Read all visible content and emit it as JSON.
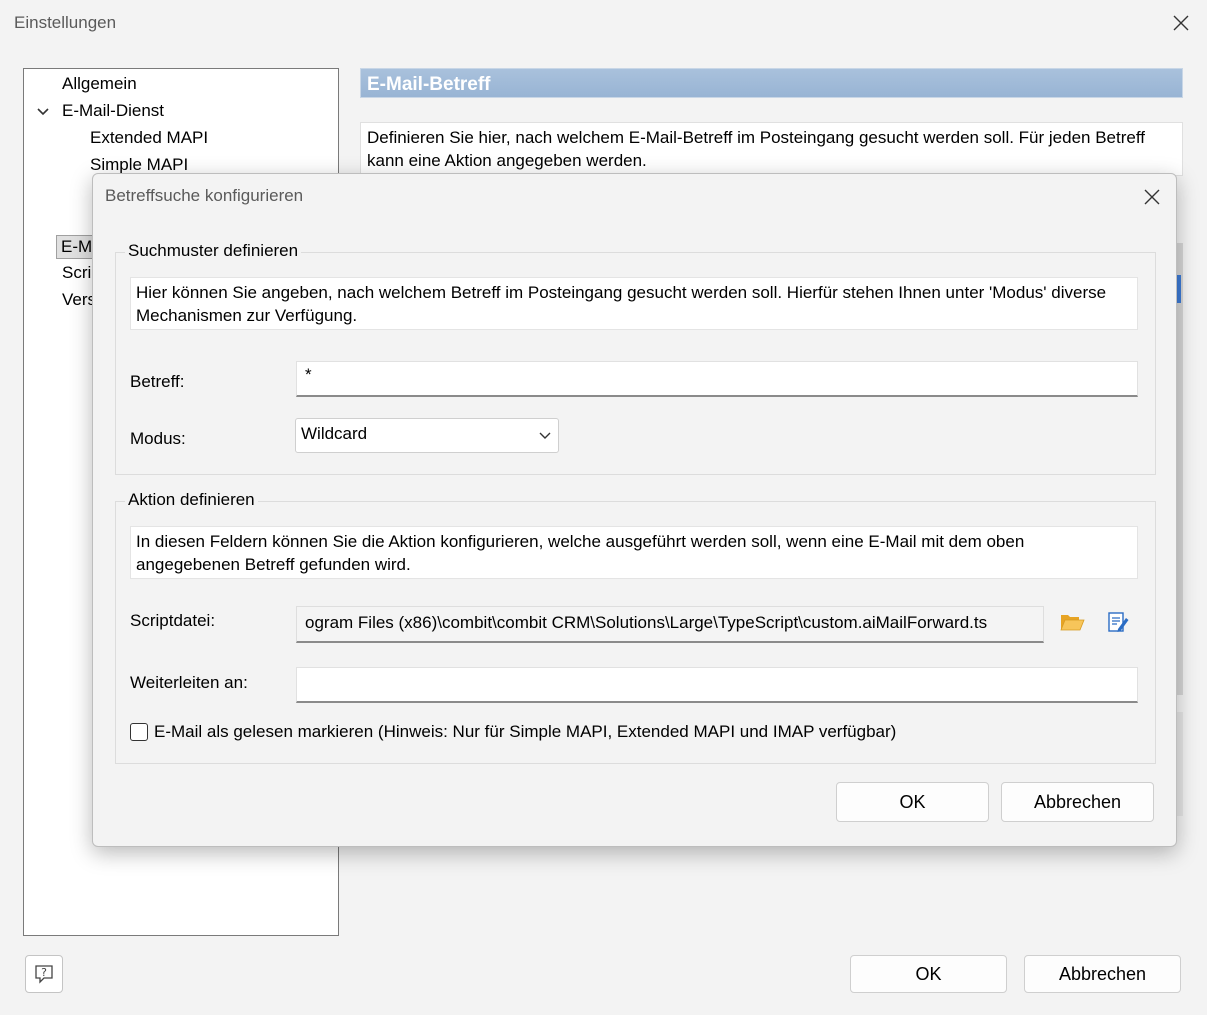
{
  "main": {
    "title": "Einstellungen",
    "tree": [
      {
        "label": "Allgemein"
      },
      {
        "label": "E-Mail-Dienst"
      },
      {
        "label": "Extended MAPI"
      },
      {
        "label": "Simple MAPI"
      },
      {
        "label": "E-M"
      },
      {
        "label": "Scri"
      },
      {
        "label": "Vers"
      }
    ],
    "section_header": "E-Mail-Betreff",
    "section_desc": "Definieren Sie hier, nach welchem E-Mail-Betreff im Posteingang gesucht werden soll. Für jeden Betreff kann eine Aktion angegeben werden.",
    "ok_label": "OK",
    "cancel_label": "Abbrechen"
  },
  "dialog": {
    "title": "Betreffsuche konfigurieren",
    "search_group": {
      "title": "Suchmuster definieren",
      "info": "Hier können Sie angeben, nach welchem Betreff im Posteingang gesucht werden soll. Hierfür stehen Ihnen unter 'Modus' diverse Mechanismen zur Verfügung.",
      "subject_label": "Betreff:",
      "subject_value": "*",
      "mode_label": "Modus:",
      "mode_value": "Wildcard"
    },
    "action_group": {
      "title": "Aktion definieren",
      "info": "In diesen Feldern können Sie die Aktion konfigurieren, welche ausgeführt werden soll, wenn eine E-Mail mit dem oben angegebenen Betreff gefunden wird.",
      "script_label": "Scriptdatei:",
      "script_value": "ogram Files (x86)\\combit\\combit CRM\\Solutions\\Large\\TypeScript\\custom.aiMailForward.ts",
      "forward_label": "Weiterleiten an:",
      "forward_value": "",
      "mark_read_label": "E-Mail als gelesen markieren (Hinweis: Nur für Simple MAPI, Extended MAPI und IMAP verfügbar)",
      "mark_read_checked": false
    },
    "ok_label": "OK",
    "cancel_label": "Abbrechen"
  },
  "icons": {
    "close": "close-icon",
    "chevron": "chevron-down-icon",
    "folder": "folder-open-icon",
    "edit": "edit-script-icon",
    "help": "help-icon"
  },
  "colors": {
    "header_blue": "#9fb9d8",
    "folder_yellow": "#f2b233",
    "edit_blue": "#2a6cc4"
  }
}
